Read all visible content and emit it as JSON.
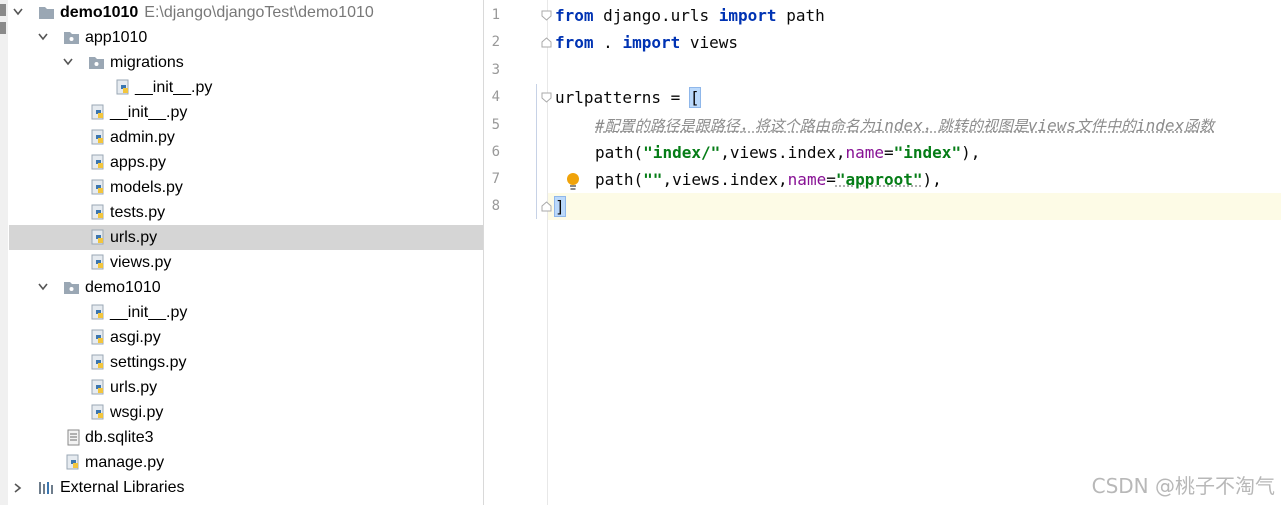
{
  "project_tree": {
    "root": {
      "name": "demo1010",
      "path": "E:\\django\\djangoTest\\demo1010"
    },
    "items": [
      {
        "label": "app1010"
      },
      {
        "label": "migrations"
      },
      {
        "label": "__init__.py"
      },
      {
        "label": "__init__.py"
      },
      {
        "label": "admin.py"
      },
      {
        "label": "apps.py"
      },
      {
        "label": "models.py"
      },
      {
        "label": "tests.py"
      },
      {
        "label": "urls.py"
      },
      {
        "label": "views.py"
      },
      {
        "label": "demo1010"
      },
      {
        "label": "__init__.py"
      },
      {
        "label": "asgi.py"
      },
      {
        "label": "settings.py"
      },
      {
        "label": "urls.py"
      },
      {
        "label": "wsgi.py"
      },
      {
        "label": "db.sqlite3"
      },
      {
        "label": "manage.py"
      },
      {
        "label": "External Libraries"
      }
    ],
    "selected_item": "urls.py"
  },
  "editor": {
    "line_numbers": [
      "1",
      "2",
      "3",
      "4",
      "5",
      "6",
      "7",
      "8"
    ],
    "current_line": "8",
    "code": {
      "l1": {
        "kw1": "from",
        "mid": " django.urls ",
        "kw2": "import",
        "tail": " path"
      },
      "l2": {
        "kw1": "from",
        "mid": " . ",
        "kw2": "import",
        "tail": " views"
      },
      "l4": {
        "head": "urlpatterns = ",
        "bracket": "["
      },
      "l5": {
        "hash": "#",
        "zh1": "配置的路径是跟路径，将这个路由命名为",
        "c1": "index",
        "zh2": "，跳转的视图是",
        "c2": "views",
        "zh3": "文件中的",
        "c3": "index",
        "zh4": "函数"
      },
      "l6": {
        "pre": "path(",
        "s1": "\"index/\"",
        "mid": ",views.index,",
        "p": "name",
        "eq": "=",
        "s2": "\"index\"",
        "end": "),"
      },
      "l7": {
        "pre": "path(",
        "s1": "\"\"",
        "mid": ",views.index,",
        "p": "name",
        "eq": "=",
        "s2": "\"approot\"",
        "end": "),"
      },
      "l8": {
        "bracket": "]"
      }
    }
  },
  "watermark": "CSDN @桃子不淘气",
  "colors": {
    "keyword": "#0033b3",
    "string": "#067d17",
    "param": "#871094",
    "comment": "#8c8c8c",
    "selection": "#d5d5d5",
    "current_line": "#fdfbe6"
  }
}
